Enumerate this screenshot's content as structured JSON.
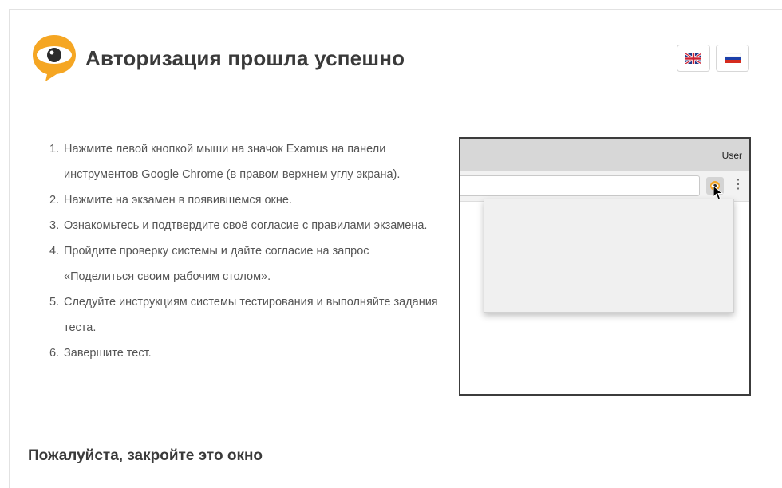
{
  "header": {
    "title": "Авторизация прошла успешно",
    "brand_color": "#f5a623"
  },
  "language_switcher": [
    {
      "code": "en",
      "icon": "uk-flag-icon"
    },
    {
      "code": "ru",
      "icon": "russia-flag-icon"
    }
  ],
  "instructions": [
    {
      "num": "1.",
      "text": "Нажмите левой кнопкой мыши на значок Examus на панели инструментов Google Chrome (в правом верхнем углу экрана)."
    },
    {
      "num": "2.",
      "text": "Нажмите на экзамен в появившемся окне."
    },
    {
      "num": "3.",
      "text": "Ознакомьтесь и подтвердите своё согласие с правилами экзамена."
    },
    {
      "num": "4.",
      "text": "Пройдите проверку системы и дайте согласие на запрос «Поделиться своим рабочим столом»."
    },
    {
      "num": "5.",
      "text": "Следуйте инструкциям системы тестирования и выполняйте задания теста."
    },
    {
      "num": "6.",
      "text": "Завершите тест."
    }
  ],
  "illustration": {
    "user_label": "User"
  },
  "footer": {
    "close_message": "Пожалуйста, закройте это окно"
  }
}
